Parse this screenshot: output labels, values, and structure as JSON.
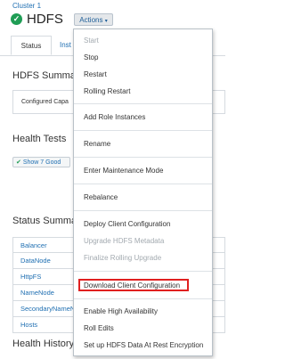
{
  "header": {
    "cluster_link": "Cluster 1",
    "service_name": "HDFS",
    "actions_label": "Actions",
    "caret": "▾"
  },
  "tabs": [
    {
      "label": "Status",
      "active": true
    },
    {
      "label": "Inst",
      "active": false
    }
  ],
  "sections": {
    "summary_title": "HDFS Summar",
    "summary_row": "Configured Capa",
    "health_tests_title": "Health Tests",
    "show_good_label": "Show 7 Good",
    "status_summary_title": "Status Summa",
    "health_history_title": "Health History"
  },
  "status_rows": [
    "Balancer",
    "DataNode",
    "HttpFS",
    "NameNode",
    "SecondaryNameN",
    "Hosts"
  ],
  "menu": {
    "items": [
      {
        "label": "Start",
        "disabled": true
      },
      {
        "label": "Stop",
        "disabled": false
      },
      {
        "label": "Restart",
        "disabled": false
      },
      {
        "label": "Rolling Restart",
        "disabled": false
      },
      {
        "label": "Add Role Instances",
        "disabled": false
      },
      {
        "label": "Rename",
        "disabled": false
      },
      {
        "label": "Enter Maintenance Mode",
        "disabled": false
      },
      {
        "label": "Rebalance",
        "disabled": false
      },
      {
        "label": "Deploy Client Configuration",
        "disabled": false
      },
      {
        "label": "Upgrade HDFS Metadata",
        "disabled": true
      },
      {
        "label": "Finalize Rolling Upgrade",
        "disabled": true
      },
      {
        "label": "Download Client Configuration",
        "disabled": false,
        "highlighted": true
      },
      {
        "label": "Enable High Availability",
        "disabled": false
      },
      {
        "label": "Roll Edits",
        "disabled": false
      },
      {
        "label": "Set up HDFS Data At Rest Encryption",
        "disabled": false
      }
    ]
  },
  "colors": {
    "link": "#1f6fb2",
    "good": "#1f9d55",
    "highlight": "#e02020",
    "disabled": "#a3aab0"
  }
}
